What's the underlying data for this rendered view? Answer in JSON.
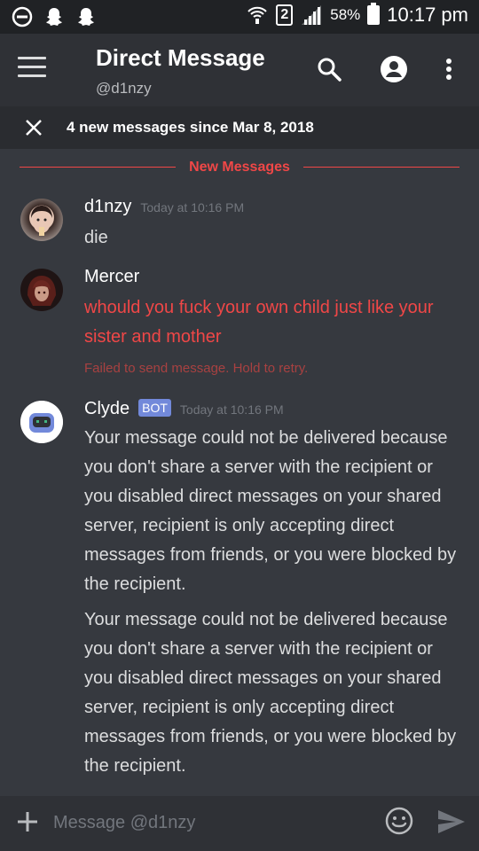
{
  "status_bar": {
    "sim_slot": "2",
    "battery": "58%",
    "time": "10:17 pm"
  },
  "header": {
    "title": "Direct Message",
    "subtitle": "@d1nzy"
  },
  "notice": {
    "text": "4 new messages since Mar 8, 2018"
  },
  "divider": {
    "label": "New Messages"
  },
  "messages": [
    {
      "author": "d1nzy",
      "timestamp": "Today at 10:16 PM",
      "text": "die"
    },
    {
      "author": "Mercer",
      "text": "whould you fuck your own child just like your sister and mother",
      "status": "Failed to send message. Hold to retry."
    },
    {
      "author": "Clyde",
      "badge": "BOT",
      "timestamp": "Today at 10:16 PM",
      "paragraphs": [
        "Your message could not be delivered because you don't share a server with the recipient or you disabled direct messages on your shared server, recipient is only accepting direct messages from friends, or you were blocked by the recipient.",
        "Your message could not be delivered because you don't share a server with the recipient or you disabled direct messages on your shared server, recipient is only accepting direct messages from friends, or you were blocked by the recipient."
      ]
    }
  ],
  "composer": {
    "placeholder": "Message @d1nzy"
  },
  "colors": {
    "background": "#36393f",
    "header": "#2f3136",
    "status_bar": "#202225",
    "error": "#f04747",
    "bot_badge": "#7289da"
  }
}
